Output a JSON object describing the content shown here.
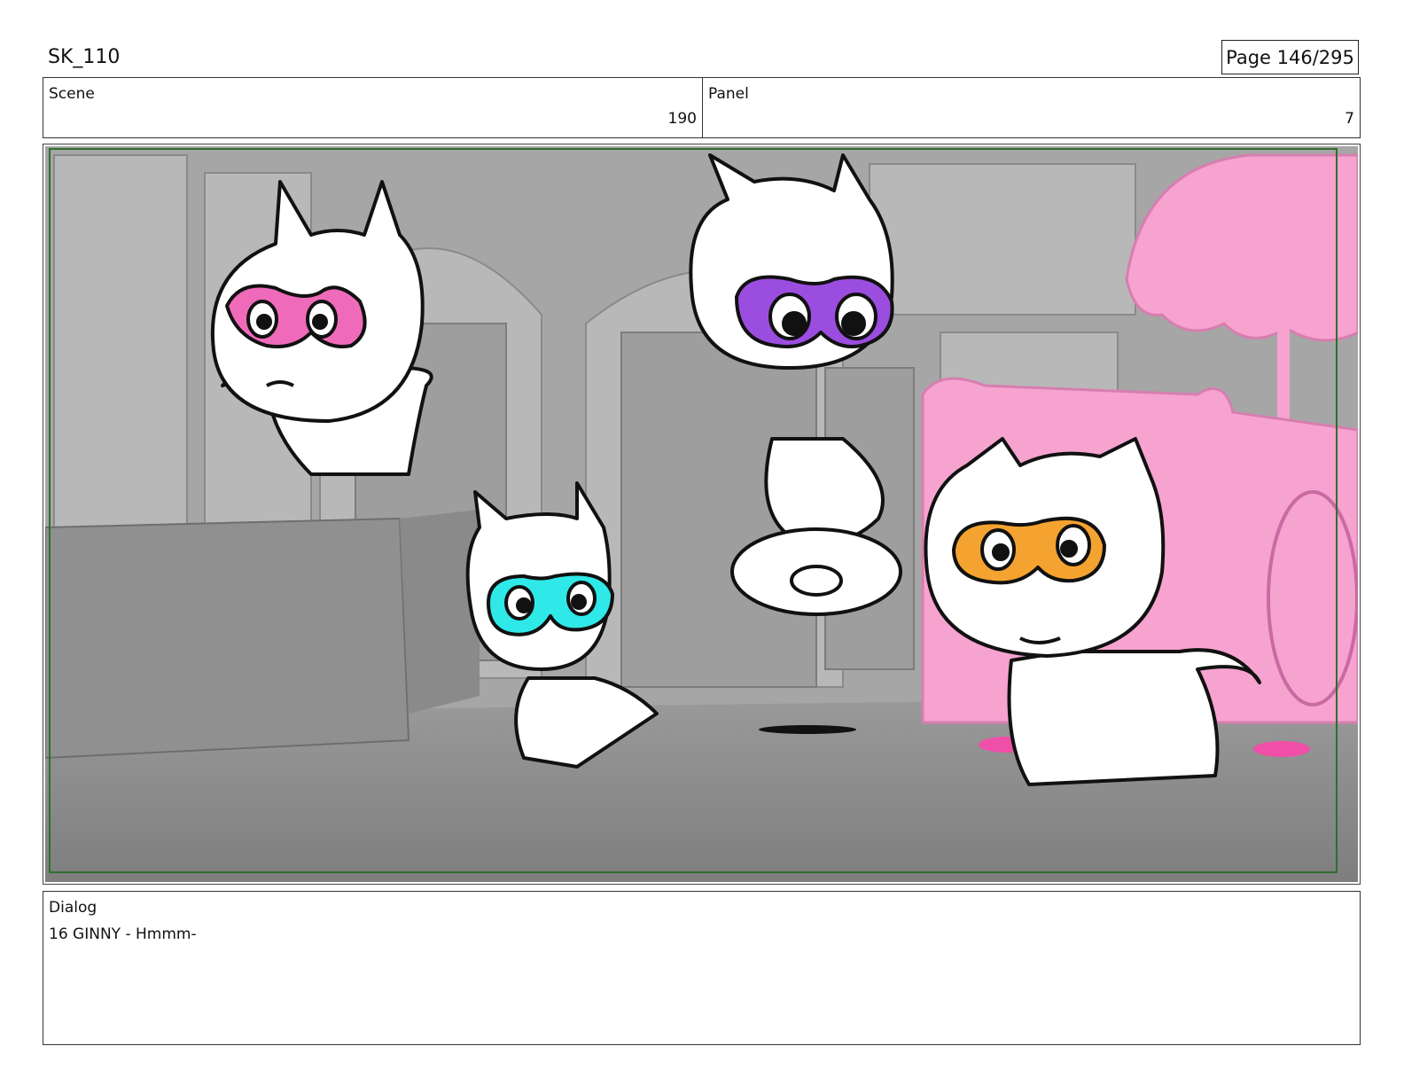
{
  "header": {
    "doc_id": "SK_110",
    "page_label": "Page 146/295"
  },
  "info": {
    "scene_label": "Scene",
    "scene_value": "190",
    "panel_label": "Panel",
    "panel_value": "7"
  },
  "frame": {
    "description_colors": {
      "pink": "#f6a3d0",
      "purple": "#9b4de0",
      "cyan": "#2fe8e8",
      "orange": "#f4a330",
      "frame_green": "#2f6e2f",
      "background_gray": "#8e8e8e"
    }
  },
  "dialog": {
    "label": "Dialog",
    "text": "16 GINNY - Hmmm-"
  }
}
